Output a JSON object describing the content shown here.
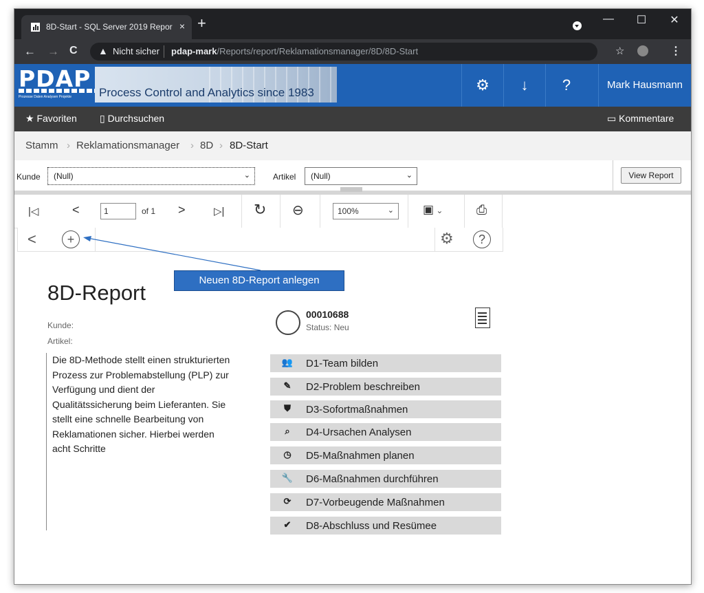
{
  "browser": {
    "tab_title": "8D-Start - SQL Server 2019 Repor",
    "tab_close": "×",
    "new_tab": "+",
    "security_label": "Nicht sicher",
    "url_host": "pdap-mark",
    "url_path": "/Reports/report/Reklamationsmanager/8D/8D-Start",
    "back_icon": "←",
    "forward_icon": "→",
    "reload_icon": "C",
    "star_icon": "☆",
    "menu_icon": "⋮",
    "minimize": "—",
    "maximize": "☐",
    "close": "✕"
  },
  "app": {
    "logo_text": "PDAP",
    "logo_subtext": "Prozesse Daten Analysen Projekte",
    "tagline": "Process Control and Analytics since 1983",
    "settings_icon": "⚙",
    "download_icon": "↓",
    "help_icon": "?",
    "user_name": "Mark Hausmann",
    "brand_color": "#1f62b5"
  },
  "favbar": {
    "favorites": "Favoriten",
    "browse": "Durchsuchen",
    "comments": "Kommentare"
  },
  "breadcrumb": [
    "Stamm",
    "Reklamationsmanager",
    "8D",
    "8D-Start"
  ],
  "params": {
    "kunde_label": "Kunde",
    "kunde_value": "(Null)",
    "artikel_label": "Artikel",
    "artikel_value": "(Null)",
    "view_report": "View Report"
  },
  "toolbar": {
    "first": "|◁",
    "prev": "<",
    "page": "1",
    "of": "of 1",
    "next": ">",
    "last": "▷|",
    "refresh": "↻",
    "back": "⊖",
    "zoom": "100%",
    "save": "💾",
    "print": "🖶"
  },
  "report_nav": {
    "back": "<",
    "add": "+",
    "gear": "⚙",
    "help": "?"
  },
  "callout": "Neuen 8D-Report anlegen",
  "report": {
    "title": "8D-Report",
    "kunde": "Kunde:",
    "artikel": "Artikel:",
    "description": "Die 8D-Methode stellt einen strukturierten Prozess zur Problemabstellung (PLP) zur Verfügung und dient der Qualitätssicherung beim Lieferanten. Sie stellt eine schnelle Bearbeitung von Reklamationen sicher. Hierbei werden acht Schritte",
    "number": "00010688",
    "status": "Status: Neu",
    "steps": [
      {
        "icon": "people-icon",
        "glyph": "👥",
        "label": "D1-Team bilden"
      },
      {
        "icon": "pencil-icon",
        "glyph": "✎",
        "label": "D2-Problem beschreiben"
      },
      {
        "icon": "shield-icon",
        "glyph": "⛊",
        "label": "D3-Sofortmaßnahmen"
      },
      {
        "icon": "search-icon",
        "glyph": "⌕",
        "label": "D4-Ursachen Analysen"
      },
      {
        "icon": "clock-icon",
        "glyph": "◷",
        "label": "D5-Maßnahmen planen"
      },
      {
        "icon": "wrench-icon",
        "glyph": "🔧",
        "label": "D6-Maßnahmen durchführen"
      },
      {
        "icon": "cycle-icon",
        "glyph": "⟳",
        "label": "D7-Vorbeugende Maßnahmen"
      },
      {
        "icon": "check-icon",
        "glyph": "✔",
        "label": "D8-Abschluss und Resümee"
      }
    ]
  }
}
